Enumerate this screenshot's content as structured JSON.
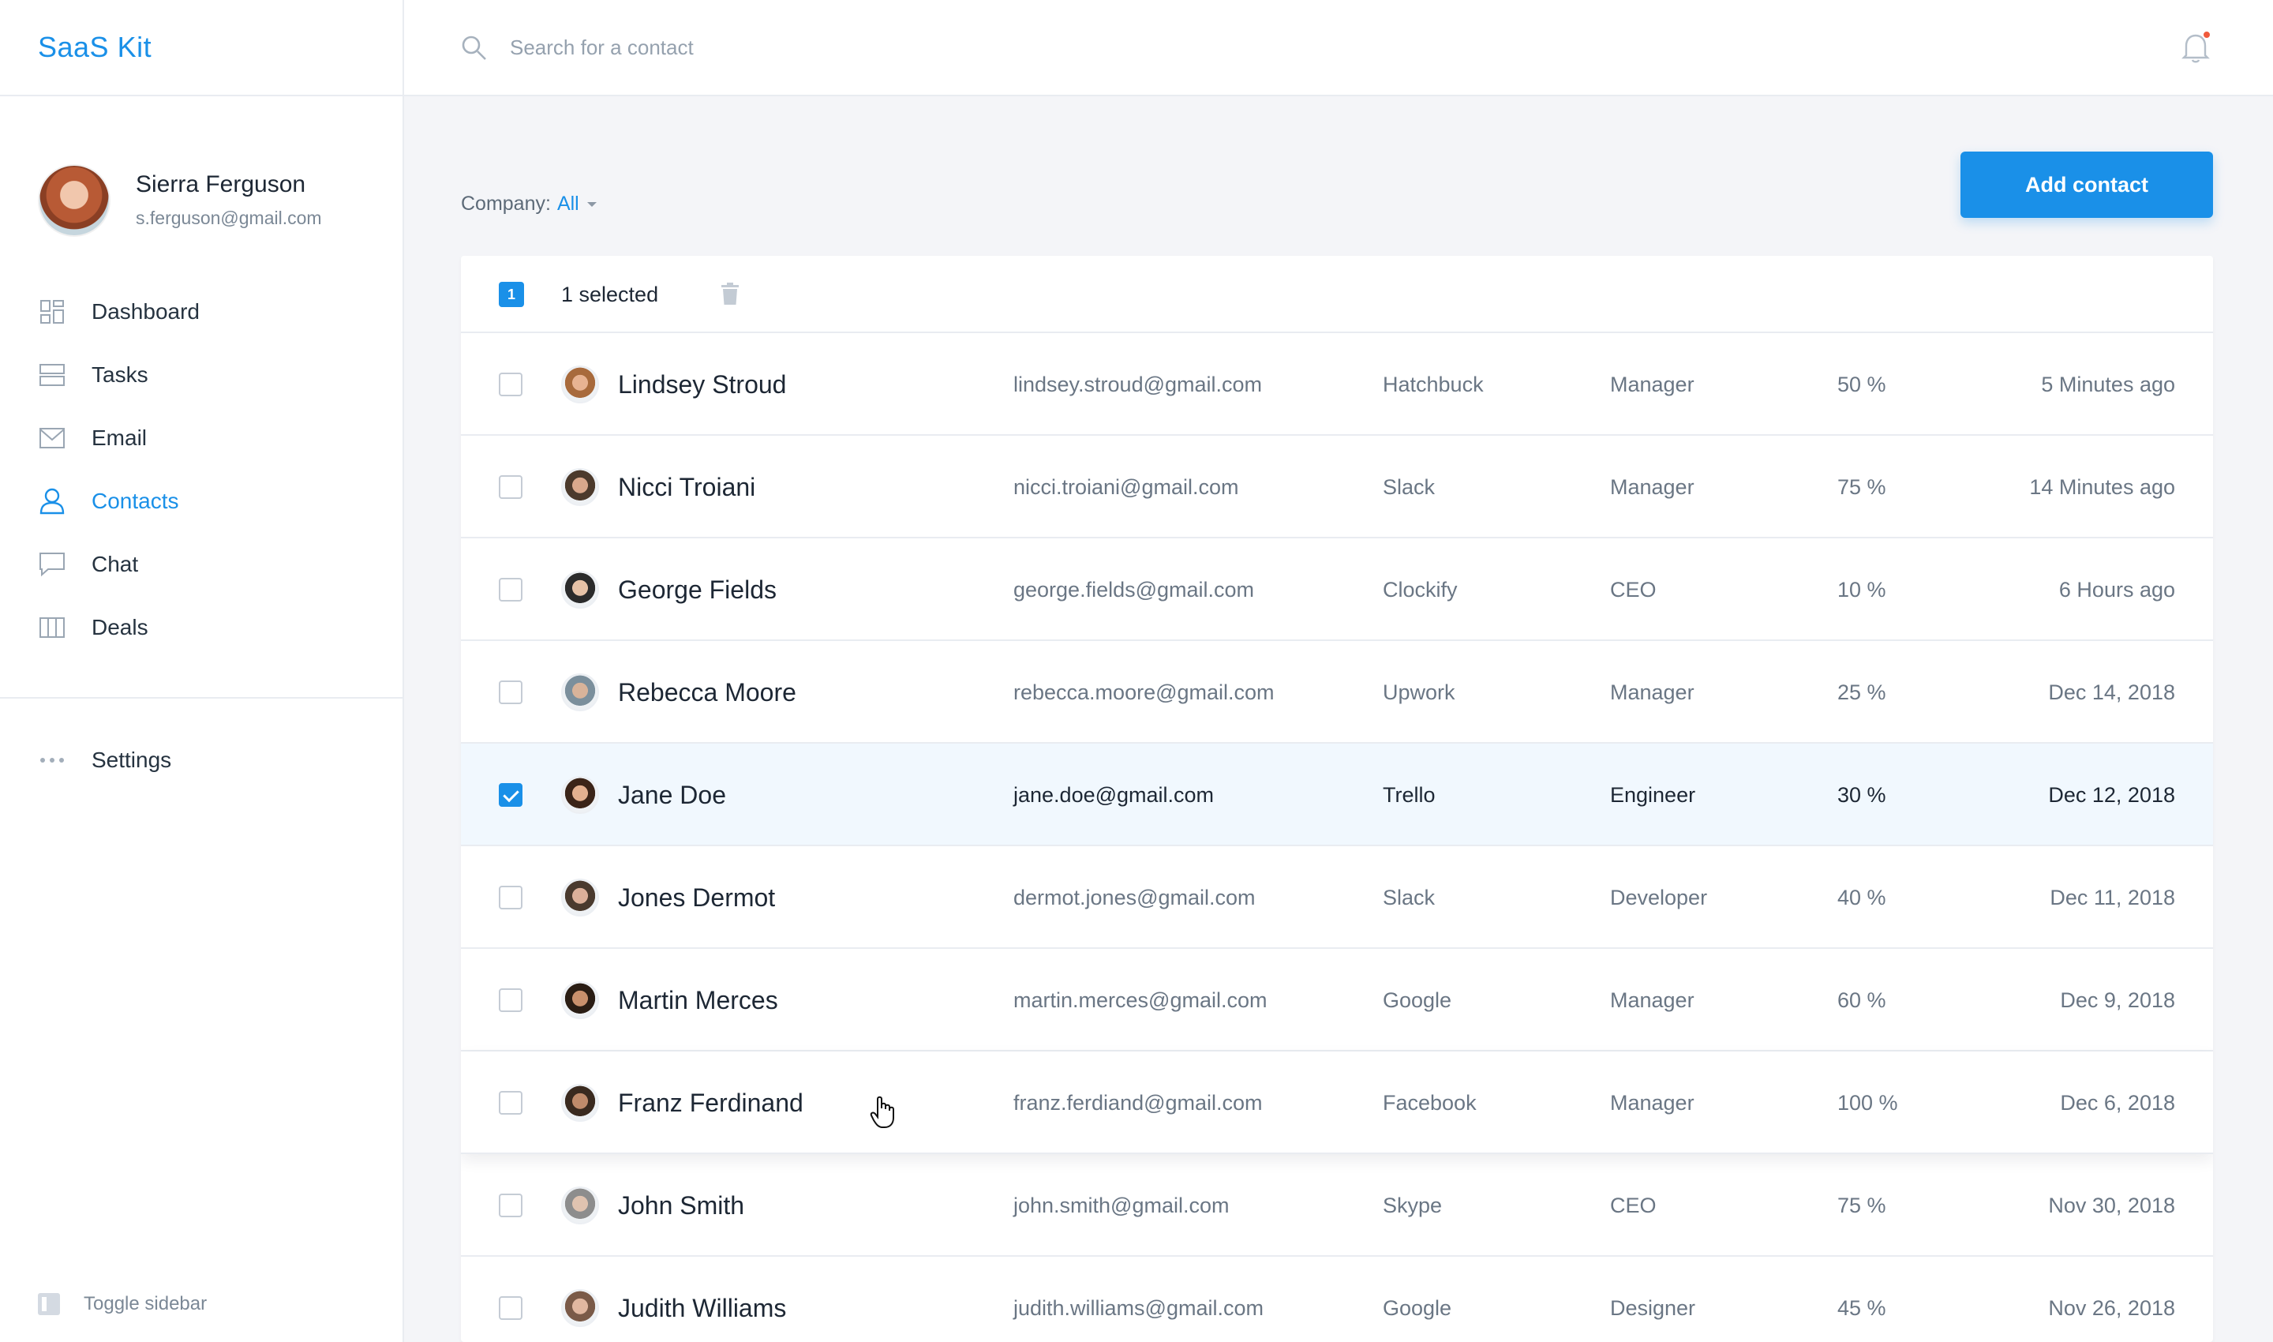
{
  "app": {
    "logo": "SaaS Kit"
  },
  "user": {
    "name": "Sierra Ferguson",
    "email": "s.ferguson@gmail.com"
  },
  "nav": {
    "items": [
      {
        "label": "Dashboard",
        "icon": "dashboard-icon"
      },
      {
        "label": "Tasks",
        "icon": "tasks-icon"
      },
      {
        "label": "Email",
        "icon": "mail-icon"
      },
      {
        "label": "Contacts",
        "icon": "user-icon",
        "active": true
      },
      {
        "label": "Chat",
        "icon": "chat-icon"
      },
      {
        "label": "Deals",
        "icon": "deals-icon"
      }
    ],
    "settings_label": "Settings",
    "toggle_label": "Toggle sidebar"
  },
  "search": {
    "placeholder": "Search for a contact"
  },
  "filter": {
    "label": "Company:",
    "value": "All"
  },
  "add_button": "Add contact",
  "selection": {
    "count": "1",
    "label": "1 selected"
  },
  "colors": {
    "accent": "#1a90e8",
    "selected_row": "#f1f8fe",
    "notification": "#f05a3c"
  },
  "contacts": [
    {
      "name": "Lindsey Stroud",
      "email": "lindsey.stroud@gmail.com",
      "company": "Hatchbuck",
      "role": "Manager",
      "percent": "50 %",
      "time": "5 Minutes ago",
      "checked": false
    },
    {
      "name": "Nicci Troiani",
      "email": "nicci.troiani@gmail.com",
      "company": "Slack",
      "role": "Manager",
      "percent": "75 %",
      "time": "14 Minutes ago",
      "checked": false
    },
    {
      "name": "George Fields",
      "email": "george.fields@gmail.com",
      "company": "Clockify",
      "role": "CEO",
      "percent": "10 %",
      "time": "6 Hours ago",
      "checked": false
    },
    {
      "name": "Rebecca Moore",
      "email": "rebecca.moore@gmail.com",
      "company": "Upwork",
      "role": "Manager",
      "percent": "25 %",
      "time": "Dec 14, 2018",
      "checked": false
    },
    {
      "name": "Jane Doe",
      "email": "jane.doe@gmail.com",
      "company": "Trello",
      "role": "Engineer",
      "percent": "30 %",
      "time": "Dec 12, 2018",
      "checked": true
    },
    {
      "name": "Jones Dermot",
      "email": "dermot.jones@gmail.com",
      "company": "Slack",
      "role": "Developer",
      "percent": "40 %",
      "time": "Dec 11, 2018",
      "checked": false
    },
    {
      "name": "Martin Merces",
      "email": "martin.merces@gmail.com",
      "company": "Google",
      "role": "Manager",
      "percent": "60 %",
      "time": "Dec 9, 2018",
      "checked": false
    },
    {
      "name": "Franz Ferdinand",
      "email": "franz.ferdiand@gmail.com",
      "company": "Facebook",
      "role": "Manager",
      "percent": "100 %",
      "time": "Dec 6, 2018",
      "checked": false
    },
    {
      "name": "John Smith",
      "email": "john.smith@gmail.com",
      "company": "Skype",
      "role": "CEO",
      "percent": "75 %",
      "time": "Nov 30, 2018",
      "checked": false
    },
    {
      "name": "Judith Williams",
      "email": "judith.williams@gmail.com",
      "company": "Google",
      "role": "Designer",
      "percent": "45 %",
      "time": "Nov 26, 2018",
      "checked": false
    }
  ]
}
